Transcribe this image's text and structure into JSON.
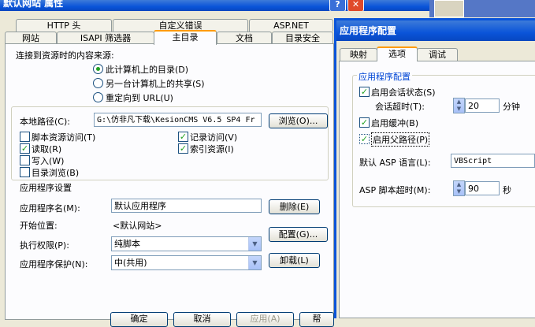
{
  "main_window": {
    "title": "默认网站 属性",
    "tabs_row1": [
      "HTTP 头",
      "自定义错误",
      "ASP.NET"
    ],
    "tabs_row2": [
      "网站",
      "ISAPI 筛选器",
      "主目录",
      "文档",
      "目录安全"
    ],
    "content_source_label": "连接到资源时的内容来源:",
    "radio_options": [
      "此计算机上的目录(D)",
      "另一台计算机上的共享(S)",
      "重定向到 URL(U)"
    ],
    "local_path_label": "本地路径(C):",
    "local_path_value": "G:\\仿非凡下载\\KesionCMS V6.5 SP4 Fr",
    "browse_button": "浏览(O)...",
    "checkboxes_left": [
      {
        "label": "脚本资源访问(T)",
        "checked": false
      },
      {
        "label": "读取(R)",
        "checked": true
      },
      {
        "label": "写入(W)",
        "checked": false
      },
      {
        "label": "目录浏览(B)",
        "checked": false
      }
    ],
    "checkboxes_right": [
      {
        "label": "记录访问(V)",
        "checked": true
      },
      {
        "label": "索引资源(I)",
        "checked": true
      }
    ],
    "app_settings_heading": "应用程序设置",
    "app_name_label": "应用程序名(M):",
    "app_name_value": "默认应用程序",
    "remove_button": "删除(E)",
    "start_point_label": "开始位置:",
    "start_point_value": "<默认网站>",
    "config_button": "配置(G)...",
    "exec_perm_label": "执行权限(P):",
    "exec_perm_value": "纯脚本",
    "app_protection_label": "应用程序保护(N):",
    "app_protection_value": "中(共用)",
    "unload_button": "卸载(L)",
    "bottom_buttons": [
      "确定",
      "取消",
      "应用(A)",
      "帮"
    ]
  },
  "config_dialog": {
    "title": "应用程序配置",
    "tabs": [
      "映射",
      "选项",
      "调试"
    ],
    "group_label": "应用程序配置",
    "enable_session_label": "启用会话状态(S)",
    "enable_session_checked": true,
    "session_timeout_label": "会话超时(T):",
    "session_timeout_value": "20",
    "session_timeout_unit": "分钟",
    "enable_buffer_label": "启用缓冲(B)",
    "enable_buffer_checked": true,
    "enable_parent_paths_label": "启用父路径(P)",
    "enable_parent_paths_checked": true,
    "default_lang_label": "默认 ASP 语言(L):",
    "default_lang_value": "VBScript",
    "script_timeout_label": "ASP 脚本超时(M):",
    "script_timeout_value": "90",
    "script_timeout_unit": "秒"
  }
}
